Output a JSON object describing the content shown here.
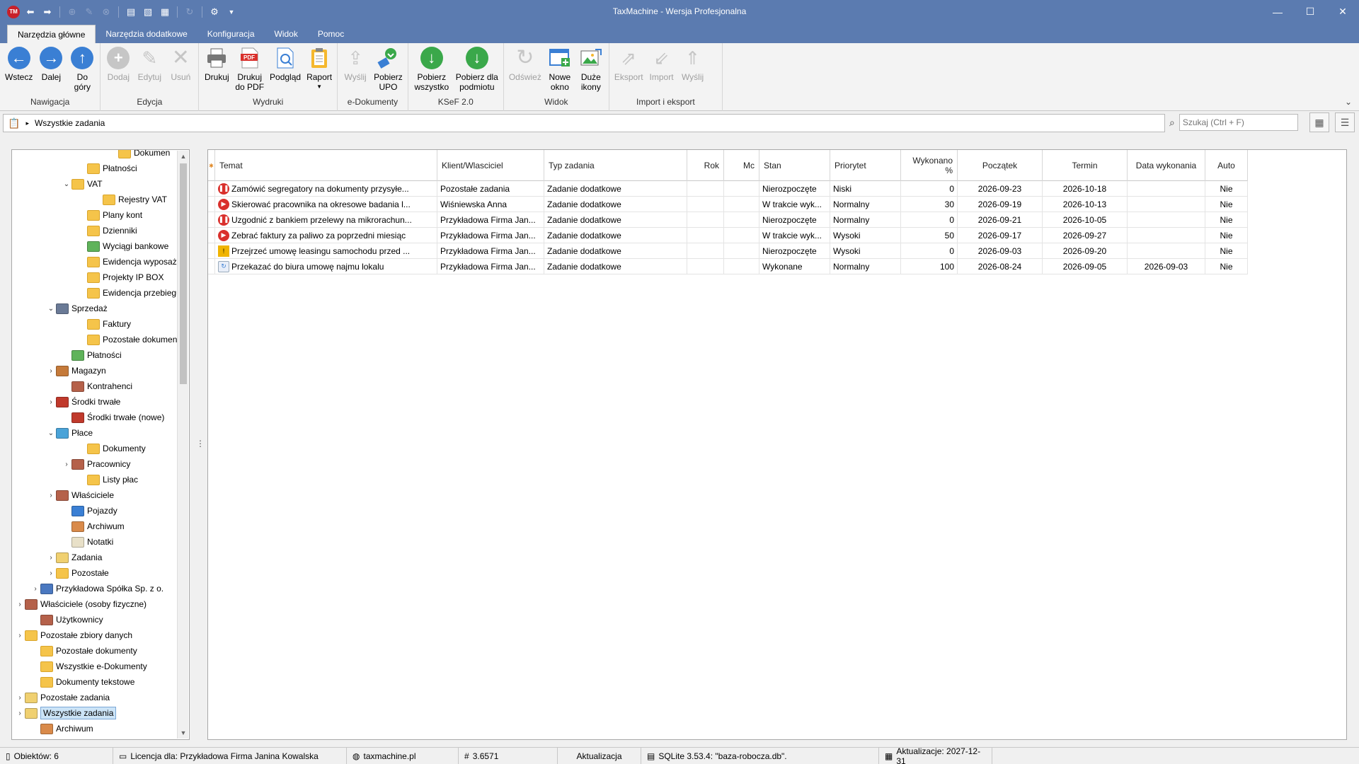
{
  "app": {
    "title": "TaxMachine  -  Wersja Profesjonalna",
    "logo": "TM"
  },
  "tabs": [
    "Narzędzia główne",
    "Narzędzia dodatkowe",
    "Konfiguracja",
    "Widok",
    "Pomoc"
  ],
  "ribbon": {
    "groups": [
      {
        "label": "Nawigacja",
        "buttons": [
          {
            "label": "Wstecz"
          },
          {
            "label": "Dalej"
          },
          {
            "label": "Do\ngóry"
          }
        ]
      },
      {
        "label": "Edycja",
        "buttons": [
          {
            "label": "Dodaj"
          },
          {
            "label": "Edytuj"
          },
          {
            "label": "Usuń"
          }
        ]
      },
      {
        "label": "Wydruki",
        "buttons": [
          {
            "label": "Drukuj"
          },
          {
            "label": "Drukuj\ndo PDF"
          },
          {
            "label": "Podgląd"
          },
          {
            "label": "Raport"
          }
        ]
      },
      {
        "label": "e-Dokumenty",
        "buttons": [
          {
            "label": "Wyślij"
          },
          {
            "label": "Pobierz\nUPO"
          }
        ]
      },
      {
        "label": "KSeF 2.0",
        "buttons": [
          {
            "label": "Pobierz\nwszystko"
          },
          {
            "label": "Pobierz dla\npodmiotu"
          }
        ]
      },
      {
        "label": "Widok",
        "buttons": [
          {
            "label": "Odśwież"
          },
          {
            "label": "Nowe\nokno"
          },
          {
            "label": "Duże\nikony"
          }
        ]
      },
      {
        "label": "Import i eksport",
        "buttons": [
          {
            "label": "Eksport"
          },
          {
            "label": "Import"
          },
          {
            "label": "Wyślij"
          }
        ]
      }
    ],
    "pdf_badge": "PDF"
  },
  "address": {
    "path": "Wszystkie zadania",
    "search_placeholder": "Szukaj (Ctrl + F)"
  },
  "tree": [
    {
      "label": "Dokumen",
      "indent": 7,
      "exp": "",
      "icon": "folder"
    },
    {
      "label": "Płatności",
      "indent": 5,
      "exp": "",
      "icon": "folder"
    },
    {
      "label": "VAT",
      "indent": 4,
      "exp": "⌄",
      "icon": "folder"
    },
    {
      "label": "Rejestry VAT",
      "indent": 6,
      "exp": "",
      "icon": "folder"
    },
    {
      "label": "Plany kont",
      "indent": 5,
      "exp": "",
      "icon": "folder"
    },
    {
      "label": "Dzienniki",
      "indent": 5,
      "exp": "",
      "icon": "folder"
    },
    {
      "label": "Wyciągi bankowe",
      "indent": 5,
      "exp": "",
      "icon": "money"
    },
    {
      "label": "Ewidencja wyposaże",
      "indent": 5,
      "exp": "",
      "icon": "folder"
    },
    {
      "label": "Projekty IP BOX",
      "indent": 5,
      "exp": "",
      "icon": "folder"
    },
    {
      "label": "Ewidencja przebiegu",
      "indent": 5,
      "exp": "",
      "icon": "folder"
    },
    {
      "label": "Sprzedaż",
      "indent": 3,
      "exp": "⌄",
      "icon": "register"
    },
    {
      "label": "Faktury",
      "indent": 5,
      "exp": "",
      "icon": "folder"
    },
    {
      "label": "Pozostałe dokumenty",
      "indent": 5,
      "exp": "",
      "icon": "folder"
    },
    {
      "label": "Płatności",
      "indent": 4,
      "exp": "",
      "icon": "money"
    },
    {
      "label": "Magazyn",
      "indent": 3,
      "exp": "›",
      "icon": "warehouse"
    },
    {
      "label": "Kontrahenci",
      "indent": 4,
      "exp": "",
      "icon": "people"
    },
    {
      "label": "Środki trwałe",
      "indent": 3,
      "exp": "›",
      "icon": "asset"
    },
    {
      "label": "Środki trwałe (nowe)",
      "indent": 4,
      "exp": "",
      "icon": "asset"
    },
    {
      "label": "Płace",
      "indent": 3,
      "exp": "⌄",
      "icon": "pay"
    },
    {
      "label": "Dokumenty",
      "indent": 5,
      "exp": "",
      "icon": "folder"
    },
    {
      "label": "Pracownicy",
      "indent": 4,
      "exp": "›",
      "icon": "people"
    },
    {
      "label": "Listy płac",
      "indent": 5,
      "exp": "",
      "icon": "folder"
    },
    {
      "label": "Właściciele",
      "indent": 3,
      "exp": "›",
      "icon": "people"
    },
    {
      "label": "Pojazdy",
      "indent": 4,
      "exp": "",
      "icon": "car"
    },
    {
      "label": "Archiwum",
      "indent": 4,
      "exp": "",
      "icon": "archive"
    },
    {
      "label": "Notatki",
      "indent": 4,
      "exp": "",
      "icon": "note"
    },
    {
      "label": "Zadania",
      "indent": 3,
      "exp": "›",
      "icon": "task"
    },
    {
      "label": "Pozostałe",
      "indent": 3,
      "exp": "›",
      "icon": "folder"
    },
    {
      "label": "Przykładowa Spółka Sp. z o.",
      "indent": 2,
      "exp": "›",
      "icon": "building"
    },
    {
      "label": "Właściciele (osoby fizyczne)",
      "indent": 1,
      "exp": "›",
      "icon": "people"
    },
    {
      "label": "Użytkownicy",
      "indent": 2,
      "exp": "",
      "icon": "people"
    },
    {
      "label": "Pozostałe zbiory danych",
      "indent": 1,
      "exp": "›",
      "icon": "folder"
    },
    {
      "label": "Pozostałe dokumenty",
      "indent": 2,
      "exp": "",
      "icon": "folder"
    },
    {
      "label": "Wszystkie e-Dokumenty",
      "indent": 2,
      "exp": "",
      "icon": "folder"
    },
    {
      "label": "Dokumenty tekstowe",
      "indent": 2,
      "exp": "",
      "icon": "folder"
    },
    {
      "label": "Pozostałe zadania",
      "indent": 1,
      "exp": "›",
      "icon": "task"
    },
    {
      "label": "Wszystkie zadania",
      "indent": 1,
      "exp": "›",
      "icon": "task",
      "selected": true
    },
    {
      "label": "Archiwum",
      "indent": 2,
      "exp": "",
      "icon": "archive"
    }
  ],
  "grid": {
    "columns": [
      {
        "key": "temat",
        "label": "Temat"
      },
      {
        "key": "klient",
        "label": "Klient/Wlasciciel"
      },
      {
        "key": "typ",
        "label": "Typ zadania"
      },
      {
        "key": "rok",
        "label": "Rok"
      },
      {
        "key": "mc",
        "label": "Mc"
      },
      {
        "key": "stan",
        "label": "Stan"
      },
      {
        "key": "priorytet",
        "label": "Priorytet"
      },
      {
        "key": "wykonano",
        "label": "Wykonano %"
      },
      {
        "key": "poczatek",
        "label": "Początek"
      },
      {
        "key": "termin",
        "label": "Termin"
      },
      {
        "key": "data_wyk",
        "label": "Data wykonania"
      },
      {
        "key": "auto",
        "label": "Auto"
      }
    ],
    "rows": [
      {
        "status": "pause",
        "temat": "Zamówić segregatory na dokumenty przysyłe...",
        "klient": "Pozostałe zadania",
        "typ": "Zadanie dodatkowe",
        "rok": "",
        "mc": "",
        "stan": "Nierozpoczęte",
        "priorytet": "Niski",
        "wykonano": "0",
        "poczatek": "2026-09-23",
        "termin": "2026-10-18",
        "data_wyk": "",
        "auto": "Nie"
      },
      {
        "status": "play",
        "temat": "Skierować pracownika na okresowe badania l...",
        "klient": "Wiśniewska Anna",
        "typ": "Zadanie dodatkowe",
        "rok": "",
        "mc": "",
        "stan": "W trakcie wyk...",
        "priorytet": "Normalny",
        "wykonano": "30",
        "poczatek": "2026-09-19",
        "termin": "2026-10-13",
        "data_wyk": "",
        "auto": "Nie"
      },
      {
        "status": "pause",
        "temat": "Uzgodnić z bankiem przelewy na mikrorachun...",
        "klient": "Przykładowa Firma Jan...",
        "typ": "Zadanie dodatkowe",
        "rok": "",
        "mc": "",
        "stan": "Nierozpoczęte",
        "priorytet": "Normalny",
        "wykonano": "0",
        "poczatek": "2026-09-21",
        "termin": "2026-10-05",
        "data_wyk": "",
        "auto": "Nie"
      },
      {
        "status": "play",
        "temat": "Zebrać faktury za paliwo za poprzedni miesiąc",
        "klient": "Przykładowa Firma Jan...",
        "typ": "Zadanie dodatkowe",
        "rok": "",
        "mc": "",
        "stan": "W trakcie wyk...",
        "priorytet": "Wysoki",
        "wykonano": "50",
        "poczatek": "2026-09-17",
        "termin": "2026-09-27",
        "data_wyk": "",
        "auto": "Nie"
      },
      {
        "status": "warn",
        "temat": "Przejrzeć umowę leasingu samochodu przed ...",
        "klient": "Przykładowa Firma Jan...",
        "typ": "Zadanie dodatkowe",
        "rok": "",
        "mc": "",
        "stan": "Nierozpoczęte",
        "priorytet": "Wysoki",
        "wykonano": "0",
        "poczatek": "2026-09-03",
        "termin": "2026-09-20",
        "data_wyk": "",
        "auto": "Nie"
      },
      {
        "status": "done",
        "temat": "Przekazać do biura umowę najmu lokalu",
        "klient": "Przykładowa Firma Jan...",
        "typ": "Zadanie dodatkowe",
        "rok": "",
        "mc": "",
        "stan": "Wykonane",
        "priorytet": "Normalny",
        "wykonano": "100",
        "poczatek": "2026-08-24",
        "termin": "2026-09-05",
        "data_wyk": "2026-09-03",
        "auto": "Nie"
      }
    ]
  },
  "status": {
    "objects": "Obiektów: 6",
    "license": "Licencja dla: Przykładowa Firma Janina Kowalska",
    "site": "taxmachine.pl",
    "version": "3.6571",
    "update": "Aktualizacja",
    "db": "SQLite 3.53.4: \"baza-robocza.db\".",
    "updates_until": "Aktualizacje: 2027-12-31"
  },
  "colors": {
    "titlebar": "#5b7bb0",
    "accent_blue": "#3a7fd4",
    "accent_green": "#3aa84a",
    "status_red": "#d9302c"
  }
}
